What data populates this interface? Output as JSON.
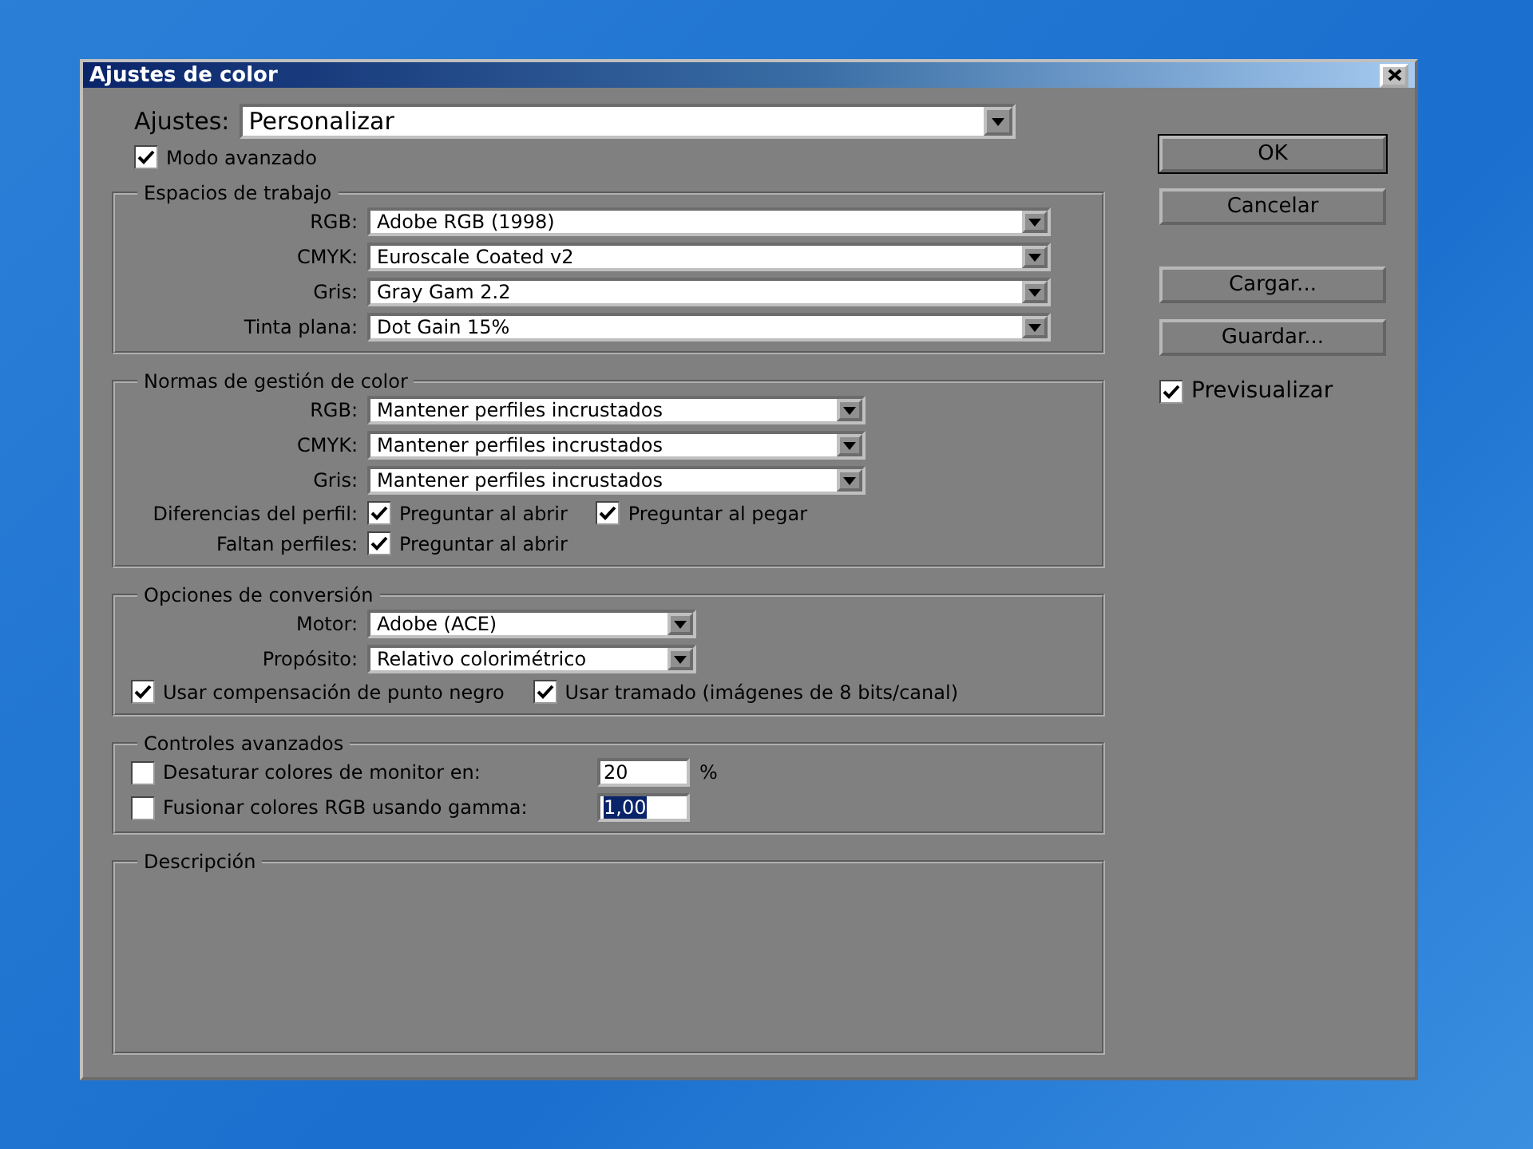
{
  "window": {
    "title": "Ajustes de color"
  },
  "settings": {
    "label": "Ajustes:",
    "value": "Personalizar"
  },
  "advanced_mode": {
    "label": "Modo avanzado",
    "checked": true
  },
  "working_spaces": {
    "title": "Espacios de trabajo",
    "rows": [
      {
        "label": "RGB:",
        "value": "Adobe RGB (1998)"
      },
      {
        "label": "CMYK:",
        "value": "Euroscale Coated v2"
      },
      {
        "label": "Gris:",
        "value": "Gray Gam 2.2"
      },
      {
        "label": "Tinta plana:",
        "value": "Dot Gain 15%"
      }
    ]
  },
  "policies": {
    "title": "Normas de gestión de color",
    "rows": [
      {
        "label": "RGB:",
        "value": "Mantener perfiles incrustados"
      },
      {
        "label": "CMYK:",
        "value": "Mantener perfiles incrustados"
      },
      {
        "label": "Gris:",
        "value": "Mantener perfiles incrustados"
      }
    ],
    "checks": [
      {
        "label": "Diferencias del perfil:",
        "options": [
          {
            "label": "Preguntar al abrir",
            "checked": true
          },
          {
            "label": "Preguntar al pegar",
            "checked": true
          }
        ]
      },
      {
        "label": "Faltan perfiles:",
        "options": [
          {
            "label": "Preguntar al abrir",
            "checked": true
          }
        ]
      }
    ]
  },
  "conversion": {
    "title": "Opciones de conversión",
    "rows": [
      {
        "label": "Motor:",
        "value": "Adobe (ACE)"
      },
      {
        "label": "Propósito:",
        "value": "Relativo colorimétrico"
      }
    ],
    "options": [
      {
        "label": "Usar compensación de punto negro",
        "checked": true
      },
      {
        "label": "Usar tramado (imágenes de 8 bits/canal)",
        "checked": true
      }
    ]
  },
  "advanced_controls": {
    "title": "Controles avanzados",
    "rows": [
      {
        "label": "Desaturar colores de monitor en:",
        "checked": false,
        "value": "20",
        "unit": "%",
        "highlighted": false
      },
      {
        "label": "Fusionar colores RGB usando gamma:",
        "checked": false,
        "value": "1,00",
        "highlighted": true
      }
    ]
  },
  "description": {
    "title": "Descripción"
  },
  "buttons": [
    {
      "label": "OK",
      "default": true
    },
    {
      "label": "Cancelar",
      "default": false
    },
    {
      "label": "Cargar...",
      "default": false
    },
    {
      "label": "Guardar...",
      "default": false
    }
  ],
  "preview": {
    "label": "Previsualizar",
    "checked": true
  }
}
